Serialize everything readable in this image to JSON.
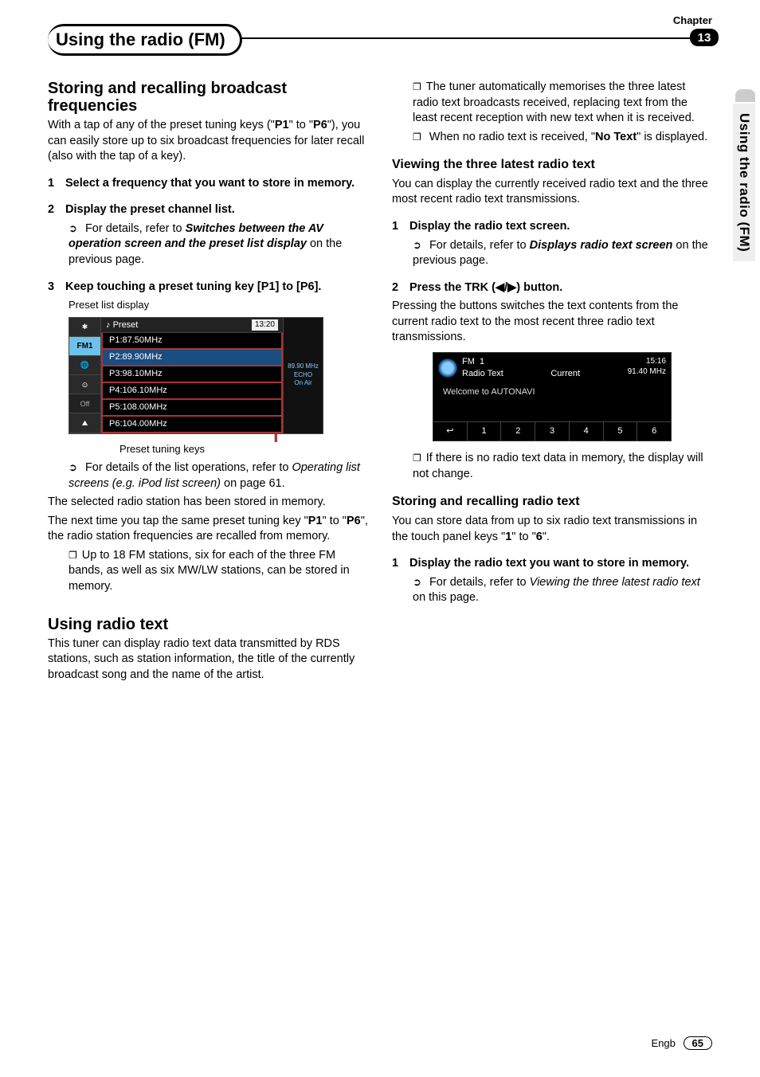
{
  "header": {
    "chapter_label": "Chapter",
    "chapter_number": "13",
    "chapter_title_a": "Using the radio (",
    "chapter_title_b": "FM",
    "chapter_title_c": ")"
  },
  "side_tab": "Using the radio (FM)",
  "left": {
    "h1": "Storing and recalling broadcast frequencies",
    "intro_a": "With a tap of any of the preset tuning keys (\"",
    "intro_p1": "P1",
    "intro_b": "\" to \"",
    "intro_p6": "P6",
    "intro_c": "\"), you can easily store up to six broadcast frequencies for later recall (also with the tap of a key).",
    "step1_num": "1",
    "step1": "Select a frequency that you want to store in memory.",
    "step2_num": "2",
    "step2": "Display the preset channel list.",
    "step2_sub_a": "For details, refer to ",
    "step2_sub_b": "Switches between the AV operation screen and the preset list display",
    "step2_sub_c": " on the previous page.",
    "step3_num": "3",
    "step3": "Keep touching a preset tuning key [P1] to [P6].",
    "fig_cap_top": "Preset list display",
    "preset_header": "Preset",
    "preset_time": "13:20",
    "presets": [
      "P1:87.50MHz",
      "P2:89.90MHz",
      "P3:98.10MHz",
      "P4:106.10MHz",
      "P5:108.00MHz",
      "P6:104.00MHz"
    ],
    "preset_side": {
      "fm": "FM1",
      "off": "Off"
    },
    "preset_right_freq": "89.90 MHz",
    "preset_right_echo": "ECHO",
    "preset_right_onair": "On Air",
    "fig_cap_bot": "Preset tuning keys",
    "sub1_a": "For details of the list operations, refer to ",
    "sub1_b": "Operating list screens (e.g. iPod list screen)",
    "sub1_c": " on page 61.",
    "p_after1": "The selected radio station has been stored in memory.",
    "p_after2_a": "The next time you tap the same preset tuning key \"",
    "p_after2_p1": "P1",
    "p_after2_b": "\" to \"",
    "p_after2_p6": "P6",
    "p_after2_c": "\", the radio station frequencies are recalled from memory.",
    "note1": "Up to 18 FM stations, six for each of the three FM bands, as well as six MW/LW stations, can be stored in memory.",
    "h2": "Using radio text",
    "p_radio": "This tuner can display radio text data transmitted by RDS stations, such as station information, the title of the currently broadcast song and the name of the artist."
  },
  "right": {
    "note_a": "The tuner automatically memorises the three latest radio text broadcasts received, replacing text from the least recent reception with new text when it is received.",
    "note_b_a": "When no radio text is received, \"",
    "note_b_bold": "No Text",
    "note_b_b": "\" is displayed.",
    "h1": "Viewing the three latest radio text",
    "p1": "You can display the currently received radio text and the three most recent radio text transmissions.",
    "step1_num": "1",
    "step1": "Display the radio text screen.",
    "step1_sub_a": "For details, refer to ",
    "step1_sub_b": "Displays radio text screen",
    "step1_sub_c": " on the previous page.",
    "step2_num": "2",
    "step2": "Press the TRK (◀/▶) button.",
    "step2_body": "Pressing the buttons switches the text contents from the current radio text to the most recent three radio text transmissions.",
    "fig": {
      "fm": "FM",
      "num": "1",
      "rtext": "Radio Text",
      "current": "Current",
      "time": "15:16",
      "freq": "91.40 MHz",
      "msg": "Welcome to AUTONAVI",
      "keys": [
        "↩",
        "1",
        "2",
        "3",
        "4",
        "5",
        "6"
      ]
    },
    "note_c": "If there is no radio text data in memory, the display will not change.",
    "h2": "Storing and recalling radio text",
    "p2_a": "You can store data from up to six radio text transmissions in the touch panel keys \"",
    "p2_k1": "1",
    "p2_b": "\" to \"",
    "p2_k6": "6",
    "p2_c": "\".",
    "step3_num": "1",
    "step3": "Display the radio text you want to store in memory.",
    "step3_sub_a": "For details, refer to ",
    "step3_sub_b": "Viewing the three latest radio text",
    "step3_sub_c": " on this page."
  },
  "footer": {
    "lang": "Engb",
    "page": "65"
  }
}
